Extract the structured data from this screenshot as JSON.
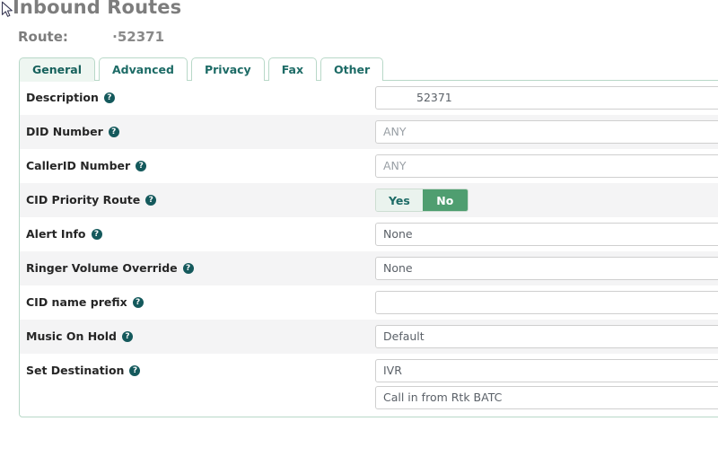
{
  "page": {
    "title": "Inbound Routes",
    "route_label": "Route:",
    "route_value": "·52371"
  },
  "tabs": [
    {
      "label": "General",
      "active": true
    },
    {
      "label": "Advanced",
      "active": false
    },
    {
      "label": "Privacy",
      "active": false
    },
    {
      "label": "Fax",
      "active": false
    },
    {
      "label": "Other",
      "active": false
    }
  ],
  "help_glyph": "?",
  "rows": [
    {
      "label": "Description",
      "type": "text",
      "value": "52371",
      "placeholder": "",
      "indent": true,
      "alt": false
    },
    {
      "label": "DID Number",
      "type": "text",
      "value": "",
      "placeholder": "ANY",
      "indent": false,
      "alt": true
    },
    {
      "label": "CallerID Number",
      "type": "text",
      "value": "",
      "placeholder": "ANY",
      "indent": false,
      "alt": false
    },
    {
      "label": "CID Priority Route",
      "type": "toggle",
      "options": [
        "Yes",
        "No"
      ],
      "selected": "No",
      "alt": true
    },
    {
      "label": "Alert Info",
      "type": "select",
      "value": "None",
      "indent": false,
      "alt": false
    },
    {
      "label": "Ringer Volume Override",
      "type": "select",
      "value": "None",
      "indent": false,
      "alt": true
    },
    {
      "label": "CID name prefix",
      "type": "text",
      "value": "",
      "placeholder": "",
      "indent": false,
      "alt": false
    },
    {
      "label": "Music On Hold",
      "type": "select",
      "value": "Default",
      "indent": false,
      "alt": true
    },
    {
      "label": "Set Destination",
      "type": "select2",
      "value": "IVR",
      "value2": "Call in from Rtk BATC",
      "alt": false
    }
  ],
  "colors": {
    "accent_green": "#4f9e70",
    "tab_text": "#1d6b66",
    "panel_border": "#b8d8c8",
    "row_alt": "#f4f4f5",
    "title_gray": "#7d7d7d"
  }
}
